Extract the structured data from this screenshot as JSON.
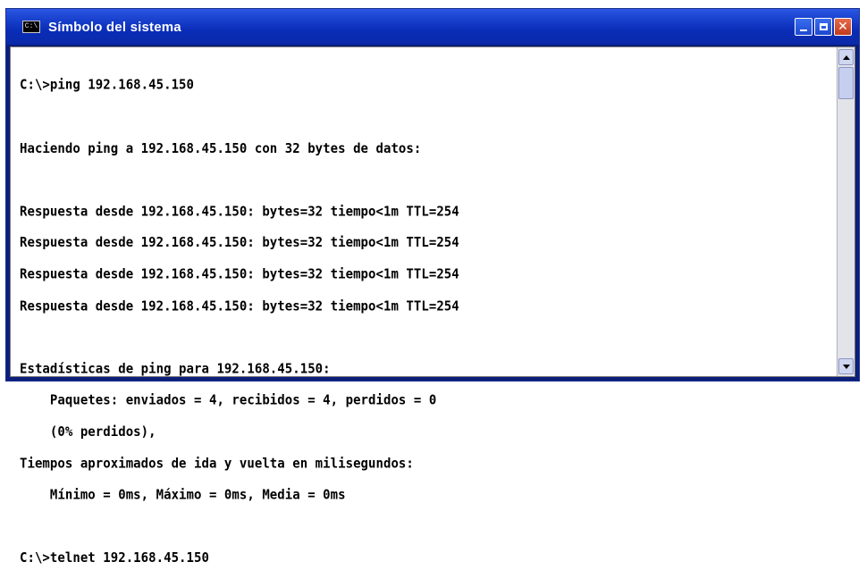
{
  "window": {
    "title": "Símbolo del sistema",
    "icon": "command-prompt-icon",
    "icon_glyph": "C:\\",
    "controls": {
      "minimize_icon": "minimize-icon",
      "maximize_icon": "maximize-icon",
      "close_icon": "close-icon",
      "close_glyph": "✕"
    },
    "colors": {
      "titlebar": "#0a2db8",
      "close_button": "#c23a1c",
      "console_background": "#ffffff",
      "console_text": "#000000"
    }
  },
  "console": {
    "lines": [
      "C:\\>ping 192.168.45.150",
      "",
      "Haciendo ping a 192.168.45.150 con 32 bytes de datos:",
      "",
      "Respuesta desde 192.168.45.150: bytes=32 tiempo<1m TTL=254",
      "Respuesta desde 192.168.45.150: bytes=32 tiempo<1m TTL=254",
      "Respuesta desde 192.168.45.150: bytes=32 tiempo<1m TTL=254",
      "Respuesta desde 192.168.45.150: bytes=32 tiempo<1m TTL=254",
      "",
      "Estadísticas de ping para 192.168.45.150:",
      "    Paquetes: enviados = 4, recibidos = 4, perdidos = 0",
      "    (0% perdidos),",
      "Tiempos aproximados de ida y vuelta en milisegundos:",
      "    Mínimo = 0ms, Máximo = 0ms, Media = 0ms",
      "",
      "C:\\>telnet 192.168.45.150"
    ]
  },
  "scrollbar": {
    "up_icon": "scroll-up-arrow-icon",
    "down_icon": "scroll-down-arrow-icon",
    "position": 0
  }
}
